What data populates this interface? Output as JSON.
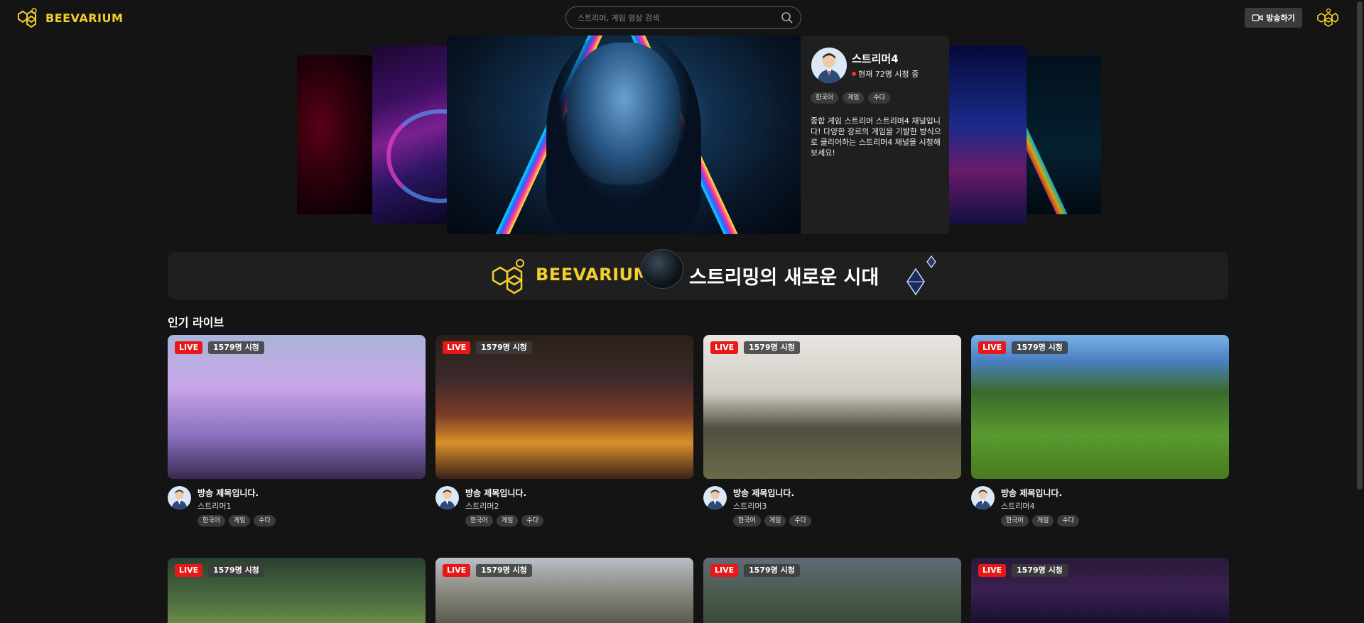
{
  "header": {
    "logo_text": "BEEVARIUM",
    "search_placeholder": "스트리머, 게임 영상 검색",
    "broadcast_label": "방송하기"
  },
  "featured": {
    "streamer": "스트리머4",
    "viewers_text": "현재 72명 시청 중",
    "tags": [
      "한국어",
      "게임",
      "수다"
    ],
    "description": "종합 게임 스트리머 스트리머4 채널입니다! 다양한 장르의 게임을 기발한 방식으로 클리어하는 스트리머4 채널을 시청해보세요!"
  },
  "banner": {
    "logo_text": "BEEVARIUM",
    "tagline": "스트리밍의 새로운 시대"
  },
  "section": {
    "title": "인기 라이브"
  },
  "cards": [
    {
      "live": "LIVE",
      "viewers": "1579명 시청",
      "title": "방송 제목입니다.",
      "streamer": "스트리머1",
      "tags": [
        "한국어",
        "게임",
        "수다"
      ]
    },
    {
      "live": "LIVE",
      "viewers": "1579명 시청",
      "title": "방송 제목입니다.",
      "streamer": "스트리머2",
      "tags": [
        "한국어",
        "게임",
        "수다"
      ]
    },
    {
      "live": "LIVE",
      "viewers": "1579명 시청",
      "title": "방송 제목입니다.",
      "streamer": "스트리머3",
      "tags": [
        "한국어",
        "게임",
        "수다"
      ]
    },
    {
      "live": "LIVE",
      "viewers": "1579명 시청",
      "title": "방송 제목입니다.",
      "streamer": "스트리머4",
      "tags": [
        "한국어",
        "게임",
        "수다"
      ]
    },
    {
      "live": "LIVE",
      "viewers": "1579명 시청"
    },
    {
      "live": "LIVE",
      "viewers": "1579명 시청"
    },
    {
      "live": "LIVE",
      "viewers": "1579명 시청"
    },
    {
      "live": "LIVE",
      "viewers": "1579명 시청"
    }
  ],
  "colors": {
    "brand": "#f2cf2e",
    "live": "#e81818",
    "background": "#141414"
  },
  "icons": [
    "bee-logo-icon",
    "search-icon",
    "video-camera-icon",
    "bee-profile-icon"
  ]
}
